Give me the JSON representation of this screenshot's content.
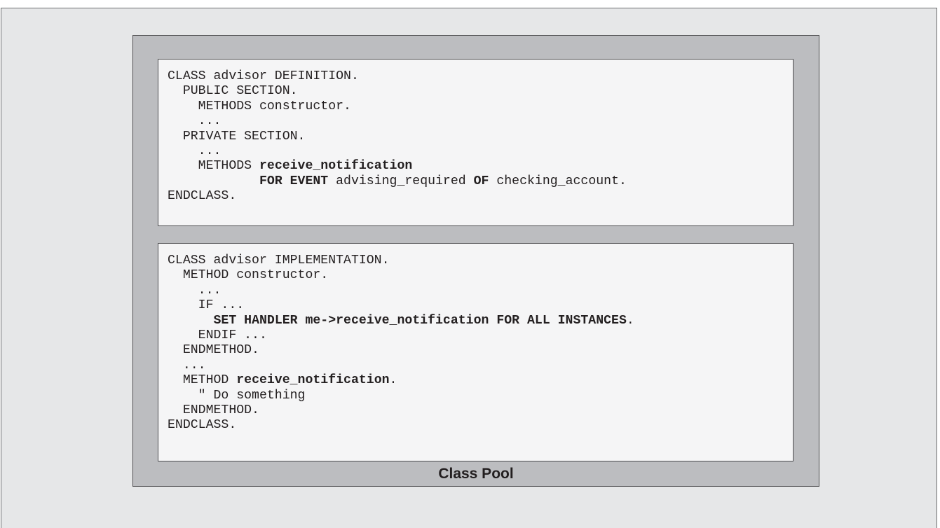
{
  "colors": {
    "outer_background": "#e6e7e8",
    "pool_background": "#bcbdc0",
    "code_background": "#f5f5f6",
    "border": "#4d4d4f",
    "text": "#231f20"
  },
  "definition_block": {
    "lines": [
      [
        {
          "t": "CLASS advisor DEFINITION.",
          "b": false
        }
      ],
      [
        {
          "t": "  PUBLIC SECTION.",
          "b": false
        }
      ],
      [
        {
          "t": "    METHODS constructor.",
          "b": false
        }
      ],
      [
        {
          "t": "    ...",
          "b": false
        }
      ],
      [
        {
          "t": "  PRIVATE SECTION.",
          "b": false
        }
      ],
      [
        {
          "t": "    ...",
          "b": false
        }
      ],
      [
        {
          "t": "    METHODS ",
          "b": false
        },
        {
          "t": "receive_notification",
          "b": true
        }
      ],
      [
        {
          "t": "            ",
          "b": false
        },
        {
          "t": "FOR EVENT",
          "b": true
        },
        {
          "t": " advising_required ",
          "b": false
        },
        {
          "t": "OF",
          "b": true
        },
        {
          "t": " checking_account.",
          "b": false
        }
      ],
      [
        {
          "t": "ENDCLASS.",
          "b": false
        }
      ]
    ]
  },
  "implementation_block": {
    "lines": [
      [
        {
          "t": "CLASS advisor IMPLEMENTATION.",
          "b": false
        }
      ],
      [
        {
          "t": "  METHOD constructor.",
          "b": false
        }
      ],
      [
        {
          "t": "    ...",
          "b": false
        }
      ],
      [
        {
          "t": "    IF ...",
          "b": false
        }
      ],
      [
        {
          "t": "      ",
          "b": false
        },
        {
          "t": "SET HANDLER me->receive_notification FOR ALL INSTANCES",
          "b": true
        },
        {
          "t": ".",
          "b": false
        }
      ],
      [
        {
          "t": "    ENDIF ...",
          "b": false
        }
      ],
      [
        {
          "t": "  ENDMETHOD.",
          "b": false
        }
      ],
      [
        {
          "t": "  ...",
          "b": false
        }
      ],
      [
        {
          "t": "  METHOD ",
          "b": false
        },
        {
          "t": "receive_notification",
          "b": true
        },
        {
          "t": ".",
          "b": false
        }
      ],
      [
        {
          "t": "    \" Do something",
          "b": false
        }
      ],
      [
        {
          "t": "  ENDMETHOD.",
          "b": false
        }
      ],
      [
        {
          "t": "ENDCLASS.",
          "b": false
        }
      ]
    ]
  },
  "pool_label": "Class Pool"
}
